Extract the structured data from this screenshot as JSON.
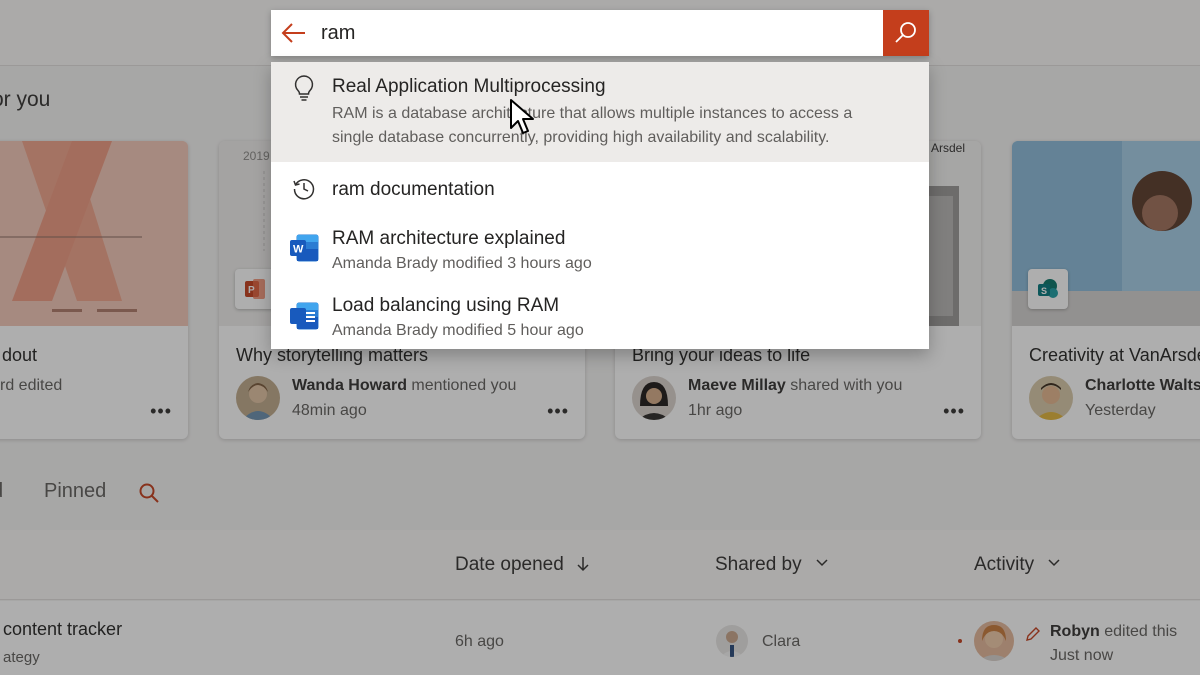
{
  "section": {
    "title": "or you"
  },
  "cards": [
    {
      "title": "dout",
      "meta_line1_tail": "rd edited",
      "meta_line2": ""
    },
    {
      "title": "Why storytelling matters",
      "person": "Wanda Howard",
      "action": "mentioned you",
      "time": "48min ago",
      "thumb_year": "2019"
    },
    {
      "title": "Bring your ideas to life",
      "person": "Maeve Millay",
      "action": "shared with you",
      "time": "1hr ago",
      "thumb_text": "Arsdel"
    },
    {
      "title": "Creativity at VanArsdel",
      "person": "Charlotte Walts",
      "action": "",
      "time": "Yesterday"
    }
  ],
  "tabs": {
    "recent": "d",
    "pinned": "Pinned"
  },
  "table": {
    "columns": {
      "date": "Date opened",
      "shared": "Shared by",
      "activity": "Activity"
    },
    "row": {
      "name": "content tracker",
      "sub": "ategy",
      "date": "6h ago",
      "shared_by": "Clara",
      "activity_person": "Robyn",
      "activity_action": "edited this",
      "activity_time": "Just now"
    }
  },
  "search": {
    "query": "ram",
    "suggestions": [
      {
        "type": "definition",
        "icon": "lightbulb-icon",
        "title": "Real Application Multiprocessing",
        "description": "RAM is a database architecture that allows multiple instances to access a single database concurrently, providing high availability and scalability."
      },
      {
        "type": "history",
        "icon": "history-icon",
        "title": "ram documentation"
      },
      {
        "type": "file",
        "icon": "word-icon",
        "title": "RAM architecture explained",
        "subtitle": "Amanda Brady modified 3 hours ago"
      },
      {
        "type": "file",
        "icon": "word-icon",
        "title": "Load balancing using RAM",
        "subtitle": "Amanda Brady modified 5 hour ago"
      }
    ]
  },
  "colors": {
    "accent": "#c43e1c",
    "word": "#185abd",
    "powerpoint": "#c43e1c",
    "sharepoint": "#077568"
  }
}
